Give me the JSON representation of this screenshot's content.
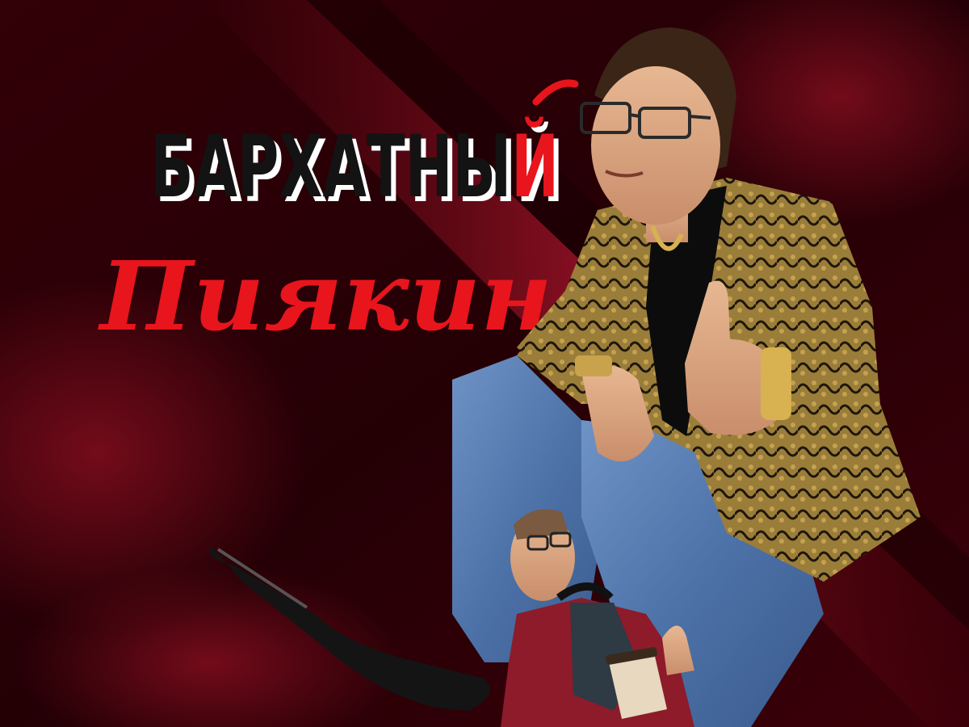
{
  "title": {
    "word1_main": "БАРХАТНЫ",
    "word1_accent": "Й",
    "word2": "Пиякин"
  },
  "colors": {
    "accent": "#e8151c",
    "velvet_dark": "#1a0004",
    "velvet_mid": "#5a0410",
    "velvet_light": "#9e1226",
    "title_text": "#131313"
  }
}
